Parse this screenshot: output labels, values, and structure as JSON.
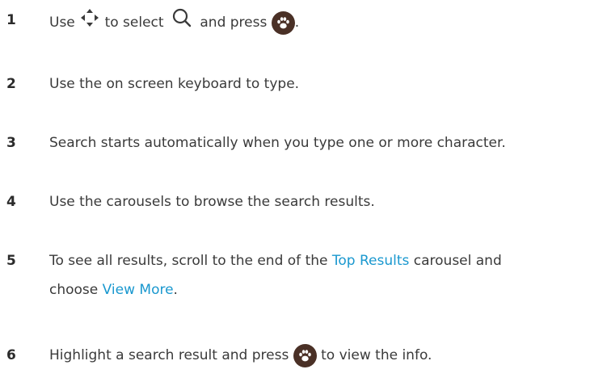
{
  "steps": [
    {
      "number": "1",
      "parts": {
        "use": "Use",
        "to_select": "to select",
        "and_press": "and press",
        "period": "."
      },
      "icons": [
        "dpad-arrows-icon",
        "search-icon",
        "paw-button-icon"
      ]
    },
    {
      "number": "2",
      "text": "Use the on screen keyboard to type."
    },
    {
      "number": "3",
      "text": "Search starts automatically when you type one or more character."
    },
    {
      "number": "4",
      "text": "Use the carousels to browse the search results."
    },
    {
      "number": "5",
      "parts": {
        "before_link": "To see all results, scroll to the end of the ",
        "link1": "Top Results",
        "middle": " carousel and",
        "line2_start": "choose ",
        "link2": "View More",
        "end": "."
      }
    },
    {
      "number": "6",
      "parts": {
        "before_icon": "Highlight a search result and press",
        "after_icon": "to view the info."
      },
      "icons": [
        "paw-button-icon"
      ]
    }
  ],
  "colors": {
    "text": "#3a3a3a",
    "link": "#1a98cf",
    "paw_button": "#4a3026"
  }
}
